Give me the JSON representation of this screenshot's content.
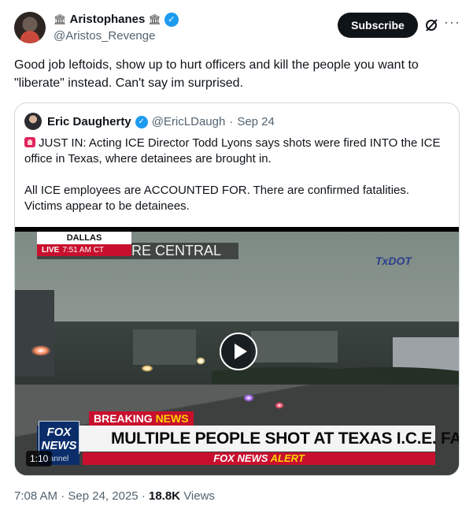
{
  "author": {
    "name": "Aristophanes",
    "name_icon": "classical-building-icon",
    "handle": "@Aristos_Revenge",
    "verified_color": "#1d9bf0"
  },
  "actions": {
    "subscribe_label": "Subscribe",
    "grok_icon": "grok-slash-icon",
    "more_icon": "more-dots-icon"
  },
  "tweet": {
    "text": "Good job leftoids, show up to hurt officers and kill the people you want to \"liberate\" instead. Can't say im surprised."
  },
  "quote": {
    "name": "Eric Daugherty",
    "handle": "@EricLDaugh",
    "separator": "·",
    "date": "Sep 24",
    "emoji_icon": "police-light-icon",
    "paragraph1": "JUST IN: Acting ICE Director Todd Lyons says shots were fired INTO the ICE office in Texas, where detainees are brought in.",
    "paragraph2": "All ICE employees are ACCOUNTED FOR. There are confirmed fatalities. Victims appear to be detainees."
  },
  "video": {
    "location": "DALLAS",
    "live_label": "LIVE",
    "live_time": "7:51 AM CT",
    "center_label": "RE CENTRAL",
    "txdot": "TxDOT",
    "breaking_prefix": "BREAKING ",
    "breaking_word": "NEWS",
    "headline": "MULTIPLE PEOPLE SHOT AT TEXAS I.C.E. FACILITY",
    "fox_line1": "FOX",
    "fox_line2": "NEWS",
    "channel": "annel",
    "alert_prefix": "FOX NEWS ",
    "alert_word": "ALERT",
    "duration": "1:10"
  },
  "meta": {
    "time": "7:08 AM",
    "dot1": "·",
    "date": "Sep 24, 2025",
    "dot2": "·",
    "views_count": "18.8K",
    "views_label": "Views"
  }
}
